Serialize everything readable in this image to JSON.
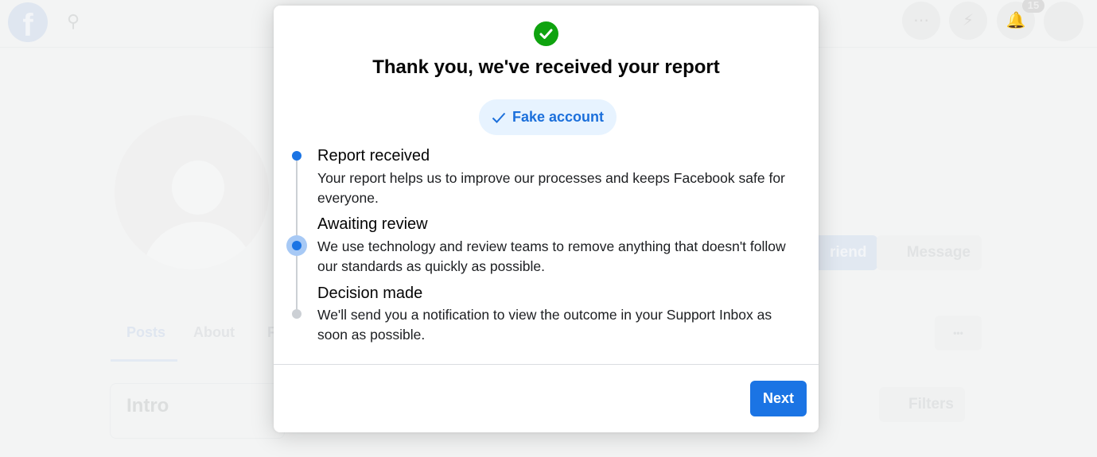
{
  "background": {
    "search_icon": "search-icon",
    "notification_count": "15",
    "tabs": [
      "Posts",
      "About",
      "F"
    ],
    "intro": "Intro",
    "add_friend": "riend",
    "message": "Message",
    "more": "•••",
    "filters": "Filters"
  },
  "modal": {
    "title": "Thank you, we've received your report",
    "category": "Fake account",
    "steps": [
      {
        "title": "Report received",
        "description": "Your report helps us to improve our processes and keeps Facebook safe for everyone.",
        "state": "done"
      },
      {
        "title": "Awaiting review",
        "description": "We use technology and review teams to remove anything that doesn't follow our standards as quickly as possible.",
        "state": "current"
      },
      {
        "title": "Decision made",
        "description": "We'll send you a notification to view the outcome in your Support Inbox as soon as possible.",
        "state": "pending"
      }
    ],
    "next_label": "Next"
  },
  "colors": {
    "accent": "#1b74e4",
    "success": "#0fa30f",
    "pill_bg": "#e7f3ff"
  }
}
